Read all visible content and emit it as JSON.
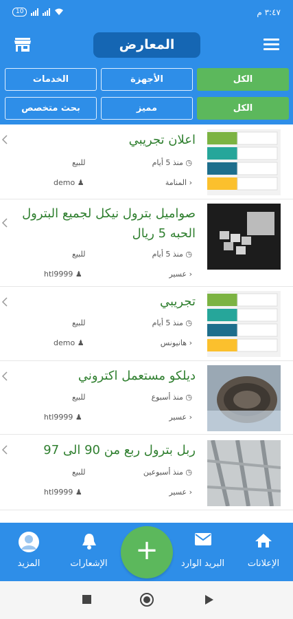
{
  "status_bar": {
    "time": "٣:٤٧ م",
    "battery": "10"
  },
  "header": {
    "title": "المعارض"
  },
  "filters": {
    "row1": [
      "الكل",
      "الأجهزة",
      "الخدمات"
    ],
    "row2": [
      "الكل",
      "مميز",
      "بحث متخصص"
    ]
  },
  "listings": [
    {
      "title": "اعلان تجريبي",
      "time": "منذ 5 أيام",
      "type": "للبيع",
      "location": "المنامة",
      "user": "demo"
    },
    {
      "title": "صواميل بترول نيكل لجميع البترول الحبه 5 ريال",
      "time": "منذ 5 أيام",
      "type": "للبيع",
      "location": "عسير",
      "user": "htl9999"
    },
    {
      "title": "تجريبي",
      "time": "منذ 5 أيام",
      "type": "للبيع",
      "location": "هانيونس",
      "user": "demo"
    },
    {
      "title": "ديلكو مستعمل اكتروني",
      "time": "منذ أسبوع",
      "type": "للبيع",
      "location": "عسير",
      "user": "htl9999"
    },
    {
      "title": "ربل بترول ربع من 90 الى 97",
      "time": "منذ أسبوعين",
      "type": "للبيع",
      "location": "عسير",
      "user": "htl9999"
    }
  ],
  "bottom_nav": {
    "ads": "الإعلانات",
    "inbox": "البريد الوارد",
    "add": "+",
    "notifications": "الإشعارات",
    "more": "المزيد"
  },
  "colors": {
    "primary": "#2e8ee8",
    "header_title_bg": "#1566b3",
    "accent_green": "#5cb85c",
    "title_green": "#2f7f2f"
  }
}
